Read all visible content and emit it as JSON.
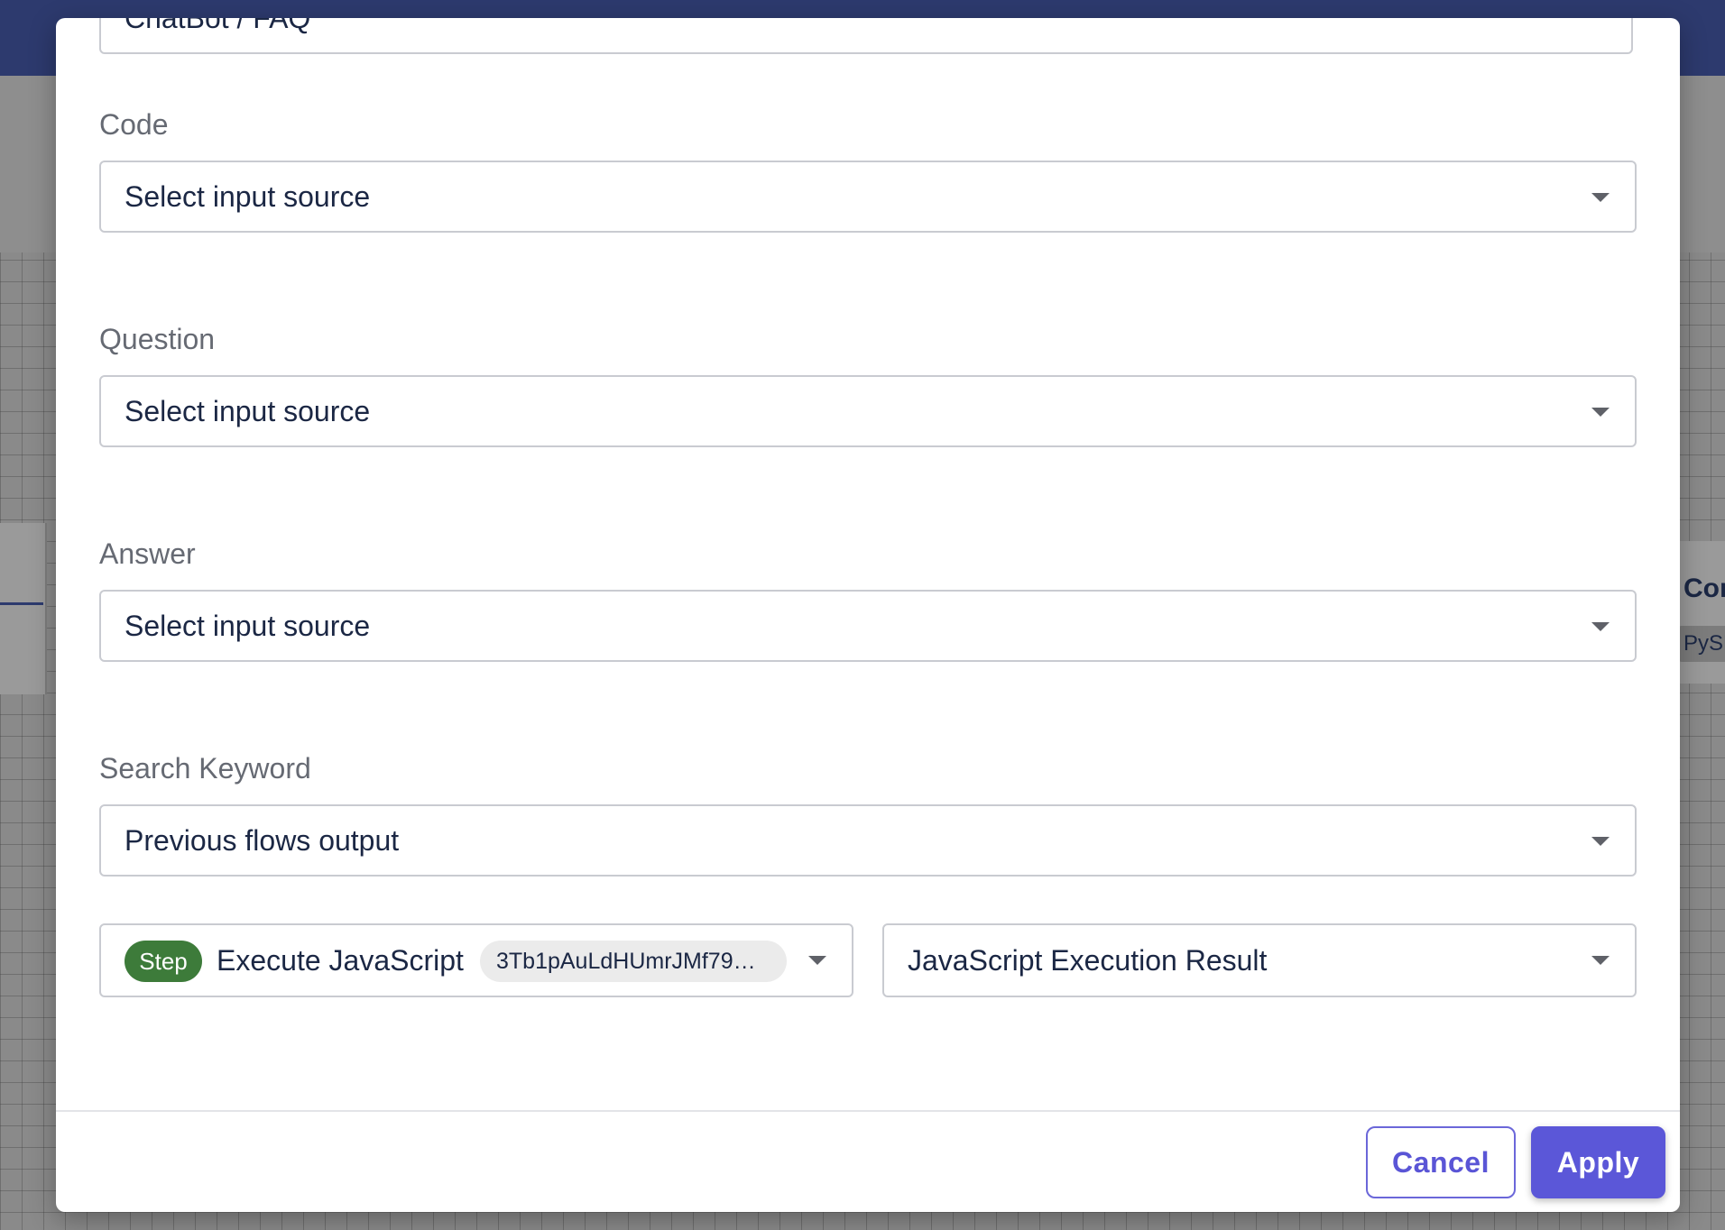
{
  "background": {
    "right_card": {
      "title": "Cor",
      "chip": "PySE"
    }
  },
  "modal": {
    "top_field_value": "ChatBot / FAQ",
    "fields": [
      {
        "label": "Code",
        "value": "Select input source"
      },
      {
        "label": "Question",
        "value": "Select input source"
      },
      {
        "label": "Answer",
        "value": "Select input source"
      },
      {
        "label": "Search Keyword",
        "value": "Previous flows output"
      }
    ],
    "step_select": {
      "badge": "Step",
      "name": "Execute JavaScript",
      "id": "3Tb1pAuLdHUmrJMf79…"
    },
    "output_select": {
      "value": "JavaScript Execution Result"
    },
    "buttons": {
      "cancel": "Cancel",
      "apply": "Apply"
    }
  },
  "colors": {
    "accent": "#5b57d8",
    "step_badge": "#3d7b3a",
    "topbar": "#2d3a6e"
  },
  "icons": [
    "chevron-down-icon"
  ]
}
